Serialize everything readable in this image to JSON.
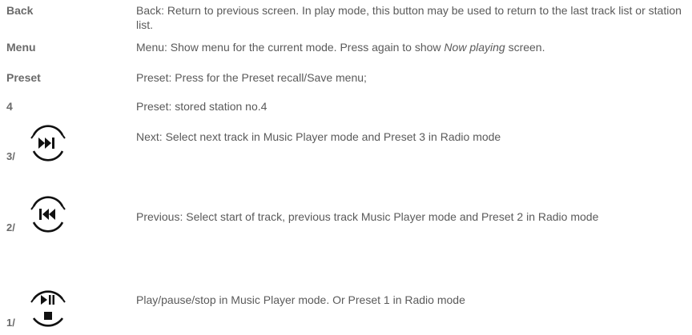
{
  "rows": [
    {
      "label": "Back",
      "description": "Back: Return to previous screen. In play mode, this button may be used to return to the last track list or station list."
    },
    {
      "label": "Menu",
      "description_before": "Menu: Show menu for the current mode. Press again to show ",
      "description_em": "Now playing",
      "description_after": " screen."
    },
    {
      "label": "Preset",
      "description": "Preset: Press for the Preset recall/Save menu;"
    },
    {
      "label": "4",
      "description": "Preset: stored station no.4"
    },
    {
      "label": "3/",
      "icon": "next-track-icon",
      "description": "Next: Select next track in Music Player mode and Preset 3 in Radio mode"
    },
    {
      "label": "2/",
      "icon": "previous-track-icon",
      "description": "Previous: Select start of track, previous track Music Player mode and Preset 2 in Radio mode"
    },
    {
      "label": "1/",
      "icon": "play-pause-stop-icon",
      "description": "Play/pause/stop in Music Player mode. Or Preset 1 in Radio mode"
    }
  ]
}
